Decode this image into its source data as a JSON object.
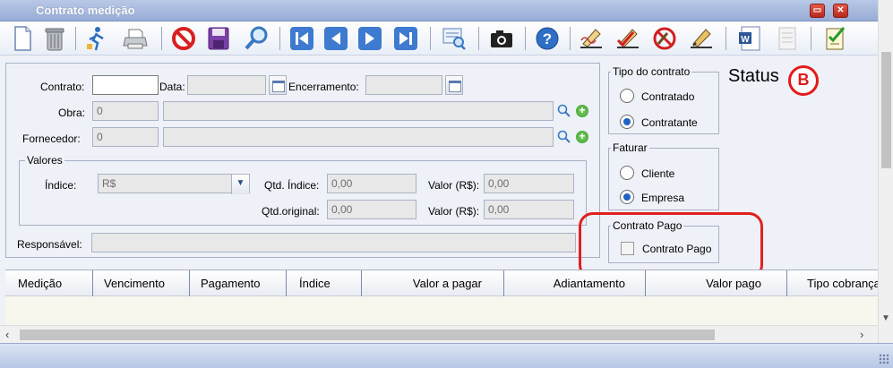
{
  "window": {
    "title": "Contrato medição",
    "minimize_icon": "minimize-icon",
    "close_icon": "close-icon"
  },
  "toolbar": {
    "icons": [
      "new-document-icon",
      "trash-icon",
      "run-icon",
      "print-icon",
      "cancel-icon",
      "save-icon",
      "search-icon",
      "first-record-icon",
      "previous-record-icon",
      "next-record-icon",
      "last-record-icon",
      "report-icon",
      "camera-icon",
      "help-icon",
      "sign-icon",
      "approve-sign-icon",
      "reject-sign-icon",
      "edit-sign-icon",
      "word-document-icon",
      "notes-icon",
      "checklist-icon"
    ]
  },
  "form": {
    "contrato_label": "Contrato:",
    "contrato_value": "",
    "data_label": "Data:",
    "data_value": "",
    "encerramento_label": "Encerramento:",
    "encerramento_value": "",
    "obra_label": "Obra:",
    "obra_code": "0",
    "obra_name": "",
    "fornecedor_label": "Fornecedor:",
    "fornecedor_code": "0",
    "fornecedor_name": "",
    "valores": {
      "title": "Valores",
      "indice_label": "Índice:",
      "indice_value": "R$",
      "qtd_indice_label": "Qtd. Índice:",
      "qtd_indice_value": "0,00",
      "valor1_label": "Valor (R$):",
      "valor1_value": "0,00",
      "qtd_original_label": "Qtd.original:",
      "qtd_original_value": "0,00",
      "valor2_label": "Valor (R$):",
      "valor2_value": "0,00"
    },
    "responsavel_label": "Responsável:",
    "responsavel_value": ""
  },
  "tipo_contrato": {
    "title": "Tipo do contrato",
    "options": [
      "Contratado",
      "Contratante"
    ],
    "selected": "Contratante"
  },
  "faturar": {
    "title": "Faturar",
    "options": [
      "Cliente",
      "Empresa"
    ],
    "selected": "Empresa"
  },
  "contrato_pago": {
    "title": "Contrato Pago",
    "checkbox_label": "Contrato Pago",
    "checked": false
  },
  "status": {
    "label": "Status",
    "badge": "B",
    "badge_color": "#e21b1b"
  },
  "grid": {
    "columns": [
      "Medição",
      "Vencimento",
      "Pagamento",
      "Índice",
      "Valor a pagar",
      "Adiantamento",
      "Valor pago",
      "Tipo cobrança"
    ]
  },
  "highlight_color": "#e02020"
}
